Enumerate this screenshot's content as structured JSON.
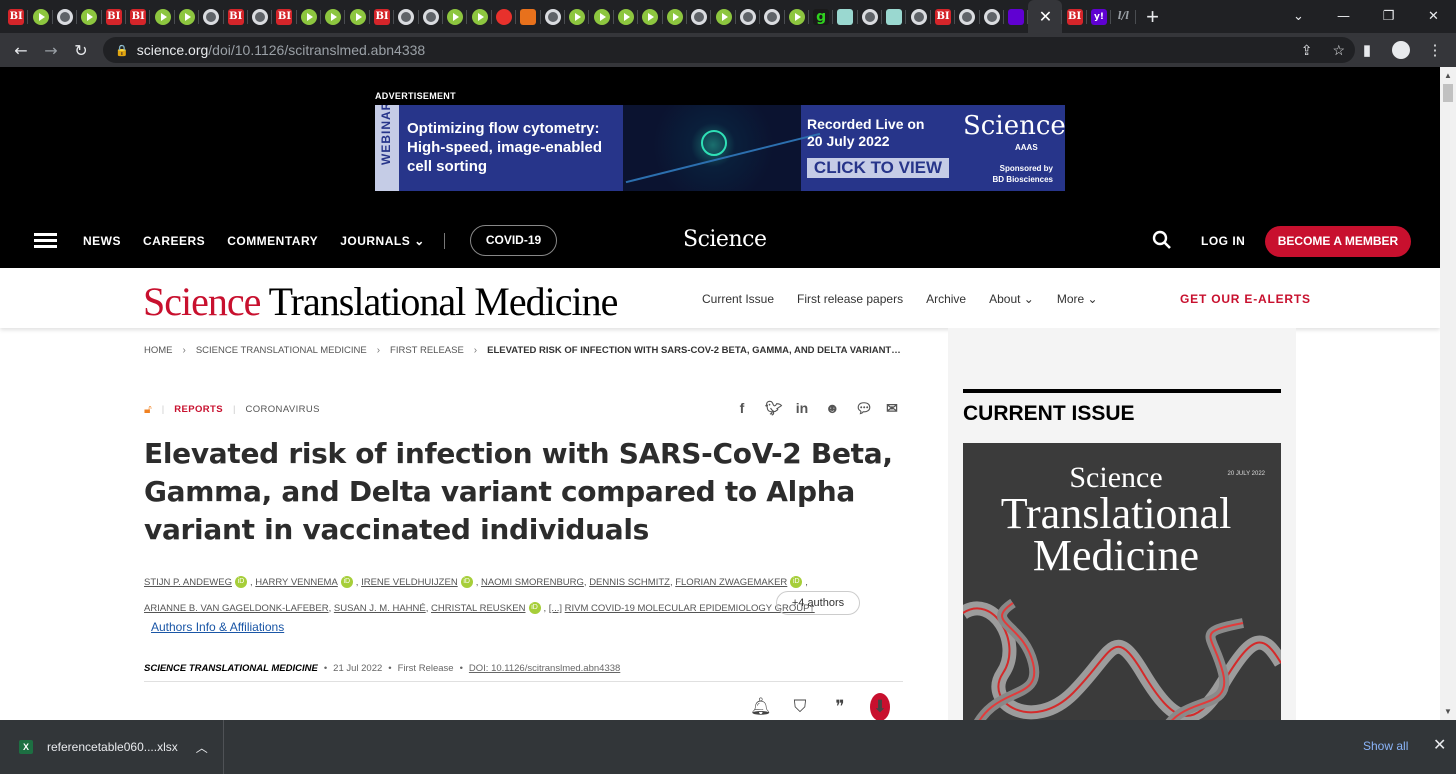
{
  "browser": {
    "tab_favicons": [
      "bi",
      "play",
      "globe",
      "play",
      "bi",
      "bi",
      "play",
      "play",
      "globe",
      "bi",
      "globe",
      "bi",
      "play",
      "play",
      "play",
      "bi",
      "globe",
      "globe",
      "play",
      "play",
      "red",
      "orange",
      "globe",
      "play",
      "play",
      "play",
      "play",
      "play",
      "globe",
      "play",
      "globe",
      "globe",
      "play",
      "g",
      "grid",
      "globe",
      "grid",
      "globe",
      "bi",
      "globe",
      "globe",
      "purple"
    ],
    "tab_favicons_after": [
      "bi",
      "yahoo",
      "ll"
    ],
    "bi_glyph": "BI",
    "g_glyph": "g",
    "yahoo_glyph": "y!",
    "ll_glyph": "l/l",
    "active_tab_close": "✕",
    "new_tab": "+",
    "url_host": "science.org",
    "url_path": "/doi/10.1126/scitranslmed.abn4338"
  },
  "ad": {
    "label": "ADVERTISEMENT",
    "side_text": "WEBINAR",
    "headline_1": "Optimizing flow cytometry:",
    "headline_2": "High-speed, image-enabled",
    "headline_3": "cell sorting",
    "recorded_1": "Recorded Live on",
    "recorded_2": "20 July 2022",
    "cta": "CLICK TO VIEW",
    "brand": "Science",
    "brand_sub": "AAAS",
    "sponsor_1": "Sponsored by",
    "sponsor_2": "BD Biosciences"
  },
  "nav": {
    "links": [
      "NEWS",
      "CAREERS",
      "COMMENTARY",
      "JOURNALS"
    ],
    "covid": "COVID-19",
    "logo": "Science",
    "login": "LOG IN",
    "member": "BECOME A MEMBER"
  },
  "journal": {
    "logo_science": "Science",
    "logo_rest": "Translational Medicine",
    "links": [
      "Current Issue",
      "First release papers",
      "Archive",
      "About",
      "More"
    ],
    "alerts": "GET OUR E-ALERTS"
  },
  "breadcrumb": [
    "HOME",
    "SCIENCE TRANSLATIONAL MEDICINE",
    "FIRST RELEASE",
    "ELEVATED RISK OF INFECTION WITH SARS-COV-2 BETA, GAMMA, AND DELTA VARIANT…"
  ],
  "article": {
    "section": "REPORTS",
    "topic": "CORONAVIRUS",
    "title": "Elevated risk of infection with SARS-CoV-2 Beta, Gamma, and Delta variant compared to Alpha variant in vaccinated individuals",
    "authors_line1": [
      "STIJN P. ANDEWEG",
      "HARRY VENNEMA",
      "IRENE VELDHUIJZEN",
      "NAOMI SMORENBURG",
      "DENNIS SCHMITZ",
      "FLORIAN ZWAGEMAKER"
    ],
    "authors_line2": [
      "ARIANNE B. VAN GAGELDONK-LAFEBER",
      "SUSAN J. M. HAHNÉ",
      "CHRISTAL REUSKEN"
    ],
    "ellipsis": "[...]",
    "group": "RIVM COVID-19 MOLECULAR EPIDEMIOLOGY GROUP†",
    "more_authors": "+4 authors",
    "affiliations": "Authors Info & Affiliations",
    "journal": "SCIENCE TRANSLATIONAL MEDICINE",
    "date": "21 Jul 2022",
    "status": "First Release",
    "doi": "DOI: 10.1126/scitranslmed.abn4338"
  },
  "sidebar": {
    "heading": "CURRENT ISSUE",
    "cover_date": "20 JULY 2022",
    "cover_line1": "Science",
    "cover_line2": "Translational",
    "cover_line3": "Medicine"
  },
  "download": {
    "filename": "referencetable060....xlsx",
    "show_all": "Show all"
  }
}
